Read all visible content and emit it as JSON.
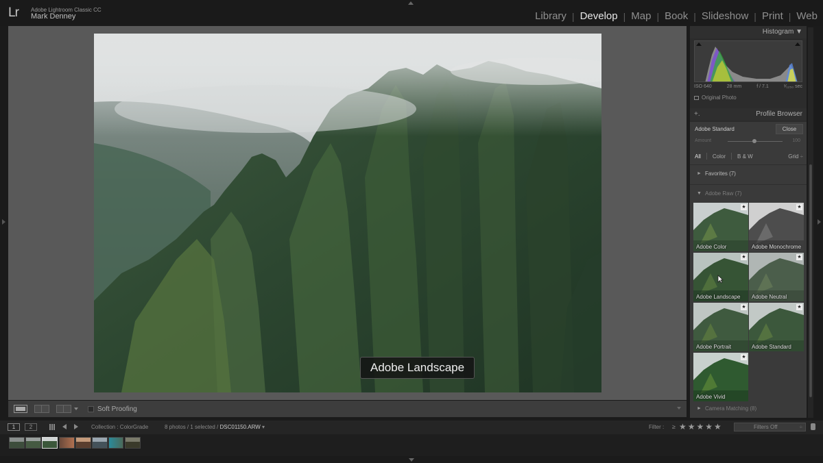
{
  "app": {
    "logo": "Lr",
    "product": "Adobe Lightroom Classic CC",
    "user": "Mark Denney"
  },
  "modules": [
    "Library",
    "Develop",
    "Map",
    "Book",
    "Slideshow",
    "Print",
    "Web"
  ],
  "active_module": "Develop",
  "photo": {
    "overlay_label": "Adobe Landscape"
  },
  "toolbar": {
    "soft_proofing": "Soft Proofing"
  },
  "histogram": {
    "title": "Histogram",
    "iso": "ISO 640",
    "focal": "28 mm",
    "aperture": "f / 7.1",
    "shutter": "¹⁄₁₂₅₀ sec",
    "original_photo": "Original Photo"
  },
  "profile_browser": {
    "plus": "+.",
    "title": "Profile Browser",
    "current_profile": "Adobe Standard",
    "close_label": "Close",
    "amount_label": "Amount",
    "amount_value": "100",
    "filters": [
      "All",
      "Color",
      "B & W"
    ],
    "view_label": "Grid",
    "groups": {
      "favorites": "Favorites (7)",
      "adobe_raw": "Adobe Raw (7)",
      "camera_matching": "Camera Matching (8)"
    },
    "profiles": [
      {
        "name": "Adobe Color"
      },
      {
        "name": "Adobe Monochrome"
      },
      {
        "name": "Adobe Landscape"
      },
      {
        "name": "Adobe Neutral"
      },
      {
        "name": "Adobe Portrait"
      },
      {
        "name": "Adobe Standard"
      },
      {
        "name": "Adobe Vivid"
      }
    ]
  },
  "filmstrip_bar": {
    "view1": "1",
    "view2": "2",
    "collection": "Collection : ColorGrade",
    "count": "8 photos / 1 selected /",
    "filename": "DSC01150.ARW",
    "filter_label": "Filter :",
    "rating_symbol": "≥",
    "stars": "★★★★★",
    "filters_off": "Filters Off"
  },
  "colors": {
    "active_module": "#e8e8e8",
    "inactive_module": "#909090",
    "canvas_bg": "#595959",
    "panel_bg": "#3a3a3a"
  }
}
